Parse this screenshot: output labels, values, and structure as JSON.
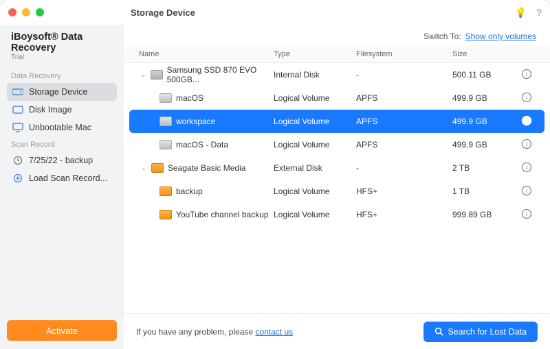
{
  "window_title": "Storage Device",
  "brand": "iBoysoft® Data Recovery",
  "trial": "Trial",
  "sections": {
    "data_recovery": "Data Recovery",
    "scan_record": "Scan Record"
  },
  "nav": {
    "storage_device": "Storage Device",
    "disk_image": "Disk Image",
    "unbootable_mac": "Unbootable Mac",
    "backup_record": "7/25/22 - backup",
    "load_scan": "Load Scan Record..."
  },
  "activate": "Activate",
  "switch_to_label": "Switch To:",
  "switch_to_link": "Show only volumes",
  "columns": {
    "name": "Name",
    "type": "Type",
    "filesystem": "Filesystem",
    "size": "Size"
  },
  "rows": [
    {
      "name": "Samsung SSD 870 EVO 500GB...",
      "type": "Internal Disk",
      "fs": "-",
      "size": "500.11 GB",
      "level": 1,
      "icon": "disk",
      "expand": true
    },
    {
      "name": "macOS",
      "type": "Logical Volume",
      "fs": "APFS",
      "size": "499.9 GB",
      "level": 2,
      "icon": "gray"
    },
    {
      "name": "workspace",
      "type": "Logical Volume",
      "fs": "APFS",
      "size": "499.9 GB",
      "level": 2,
      "icon": "gray",
      "selected": true
    },
    {
      "name": "macOS - Data",
      "type": "Logical Volume",
      "fs": "APFS",
      "size": "499.9 GB",
      "level": 2,
      "icon": "gray"
    },
    {
      "name": "Seagate Basic Media",
      "type": "External Disk",
      "fs": "-",
      "size": "2 TB",
      "level": 1,
      "icon": "orange-disk",
      "expand": true
    },
    {
      "name": "backup",
      "type": "Logical Volume",
      "fs": "HFS+",
      "size": "1 TB",
      "level": 2,
      "icon": "orange"
    },
    {
      "name": "YouTube channel backup",
      "type": "Logical Volume",
      "fs": "HFS+",
      "size": "999.89 GB",
      "level": 2,
      "icon": "orange"
    }
  ],
  "footer_text": "If you have any problem, please ",
  "footer_link": "contact us",
  "search_button": "Search for Lost Data"
}
